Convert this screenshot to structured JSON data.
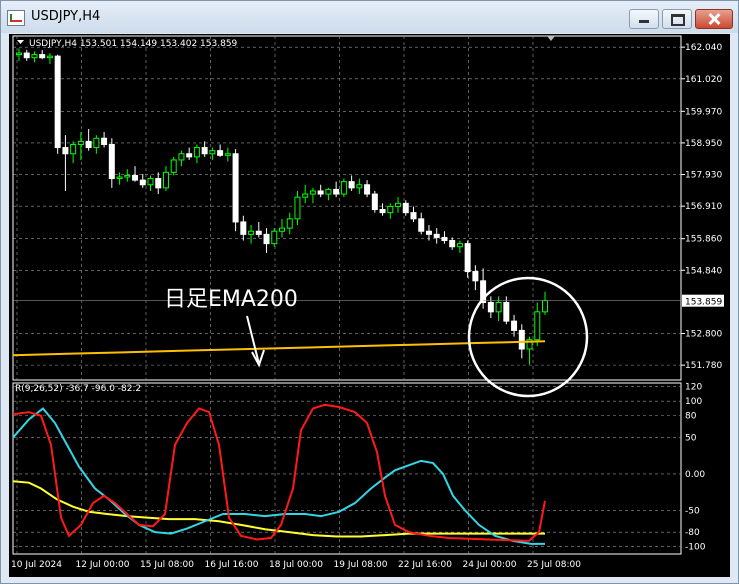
{
  "window": {
    "title": "USDJPY,H4"
  },
  "main_panel": {
    "header": "USDJPY,H4  153.501 154.149 153.402 153.859",
    "annotation": "日足EMA200",
    "price_axis": [
      "162.040",
      "161.020",
      "159.970",
      "158.950",
      "157.930",
      "156.910",
      "155.860",
      "154.840",
      "152.800",
      "151.780"
    ],
    "current_price": "153.859"
  },
  "sub_panel": {
    "header": "R(9,26,52) -36.7 -96.0 -82.2",
    "axis": [
      "120",
      "100",
      "80",
      "50",
      "0.00",
      "-50",
      "-80",
      "-100"
    ]
  },
  "time_axis": [
    "10 Jul 2024",
    "12 Jul 00:00",
    "15 Jul 08:00",
    "16 Jul 16:00",
    "18 Jul 00:00",
    "19 Jul 08:00",
    "22 Jul 16:00",
    "24 Jul 00:00",
    "25 Jul 08:00"
  ],
  "colors": {
    "background": "#000000",
    "bull": "#00ff00",
    "bear": "#ffffff",
    "ema": "#ffc000",
    "osc_red": "#ff1a1a",
    "osc_cyan": "#33d6e6",
    "osc_yellow": "#ffff33",
    "highlight": "#ffffff"
  },
  "chart_data": [
    {
      "type": "candlestick",
      "title": "USDJPY,H4",
      "yrange": [
        151.3,
        162.4
      ],
      "candles": [
        [
          161.8,
          162.0,
          161.6,
          161.85
        ],
        [
          161.85,
          161.95,
          161.6,
          161.7
        ],
        [
          161.7,
          161.9,
          161.55,
          161.8
        ],
        [
          161.8,
          161.95,
          161.65,
          161.7
        ],
        [
          161.7,
          161.85,
          161.5,
          161.75
        ],
        [
          161.75,
          161.8,
          158.6,
          158.8
        ],
        [
          158.8,
          159.2,
          157.4,
          158.6
        ],
        [
          158.6,
          159.0,
          158.3,
          158.9
        ],
        [
          158.9,
          159.3,
          158.4,
          159.0
        ],
        [
          159.0,
          159.4,
          158.7,
          158.8
        ],
        [
          158.8,
          159.2,
          158.6,
          159.1
        ],
        [
          159.1,
          159.3,
          158.8,
          158.9
        ],
        [
          158.9,
          159.1,
          157.5,
          157.8
        ],
        [
          157.8,
          158.0,
          157.6,
          157.85
        ],
        [
          157.85,
          158.1,
          157.7,
          157.9
        ],
        [
          157.9,
          158.2,
          157.7,
          157.75
        ],
        [
          157.75,
          157.95,
          157.5,
          157.6
        ],
        [
          157.6,
          157.9,
          157.4,
          157.8
        ],
        [
          157.8,
          158.0,
          157.3,
          157.5
        ],
        [
          157.5,
          158.2,
          157.4,
          158.0
        ],
        [
          158.0,
          158.5,
          157.9,
          158.4
        ],
        [
          158.4,
          158.7,
          158.2,
          158.6
        ],
        [
          158.6,
          158.8,
          158.4,
          158.5
        ],
        [
          158.5,
          158.9,
          158.3,
          158.8
        ],
        [
          158.8,
          159.0,
          158.5,
          158.6
        ],
        [
          158.6,
          158.8,
          158.4,
          158.7
        ],
        [
          158.7,
          158.9,
          158.5,
          158.55
        ],
        [
          158.55,
          158.8,
          158.35,
          158.6
        ],
        [
          158.6,
          158.75,
          156.1,
          156.4
        ],
        [
          156.4,
          156.6,
          155.8,
          156.0
        ],
        [
          156.0,
          156.3,
          155.7,
          156.1
        ],
        [
          156.1,
          156.4,
          155.9,
          156.0
        ],
        [
          156.0,
          156.2,
          155.4,
          155.7
        ],
        [
          155.7,
          156.2,
          155.6,
          156.1
        ],
        [
          156.1,
          156.5,
          155.9,
          156.2
        ],
        [
          156.2,
          156.7,
          156.0,
          156.5
        ],
        [
          156.5,
          157.4,
          156.3,
          157.2
        ],
        [
          157.2,
          157.6,
          157.0,
          157.3
        ],
        [
          157.3,
          157.5,
          157.0,
          157.4
        ],
        [
          157.4,
          157.6,
          157.2,
          157.3
        ],
        [
          157.3,
          157.5,
          157.1,
          157.45
        ],
        [
          157.45,
          157.7,
          157.2,
          157.3
        ],
        [
          157.3,
          157.8,
          157.2,
          157.7
        ],
        [
          157.7,
          157.9,
          157.4,
          157.5
        ],
        [
          157.5,
          157.8,
          157.3,
          157.6
        ],
        [
          157.6,
          157.75,
          157.2,
          157.3
        ],
        [
          157.3,
          157.4,
          156.7,
          156.8
        ],
        [
          156.8,
          157.0,
          156.6,
          156.7
        ],
        [
          156.7,
          157.0,
          156.5,
          156.9
        ],
        [
          156.9,
          157.2,
          156.7,
          157.0
        ],
        [
          157.0,
          157.1,
          156.6,
          156.7
        ],
        [
          156.7,
          156.9,
          156.4,
          156.5
        ],
        [
          156.5,
          156.7,
          156.0,
          156.1
        ],
        [
          156.1,
          156.3,
          155.8,
          156.0
        ],
        [
          156.0,
          156.2,
          155.7,
          155.9
        ],
        [
          155.9,
          156.1,
          155.7,
          155.8
        ],
        [
          155.8,
          155.9,
          155.5,
          155.6
        ],
        [
          155.6,
          155.8,
          155.4,
          155.7
        ],
        [
          155.7,
          155.8,
          154.6,
          154.8
        ],
        [
          154.8,
          155.0,
          154.2,
          154.5
        ],
        [
          154.5,
          154.9,
          153.6,
          153.8
        ],
        [
          153.8,
          154.0,
          153.3,
          153.5
        ],
        [
          153.5,
          154.0,
          153.2,
          153.8
        ],
        [
          153.8,
          154.0,
          153.1,
          153.2
        ],
        [
          153.2,
          153.4,
          152.7,
          152.9
        ],
        [
          152.9,
          153.1,
          152.0,
          152.3
        ],
        [
          152.3,
          152.7,
          151.8,
          152.6
        ],
        [
          152.6,
          153.8,
          152.4,
          153.5
        ],
        [
          153.5,
          154.15,
          153.4,
          153.86
        ]
      ],
      "ema200": [
        152.1,
        152.15,
        152.2,
        152.25,
        152.3,
        152.35,
        152.4,
        152.45,
        152.5,
        152.55
      ],
      "current_price": 153.859,
      "annotations": [
        "日足EMA200"
      ]
    },
    {
      "type": "line",
      "title": "R(9,26,52) -36.7 -96.0 -82.2",
      "ylim": [
        -110,
        125
      ],
      "series": [
        {
          "color": "#ff1a1a",
          "values": [
            -36.7
          ]
        },
        {
          "color": "#33d6e6",
          "values": [
            -96.0
          ]
        },
        {
          "color": "#ffff33",
          "values": [
            -82.2
          ]
        }
      ]
    }
  ]
}
